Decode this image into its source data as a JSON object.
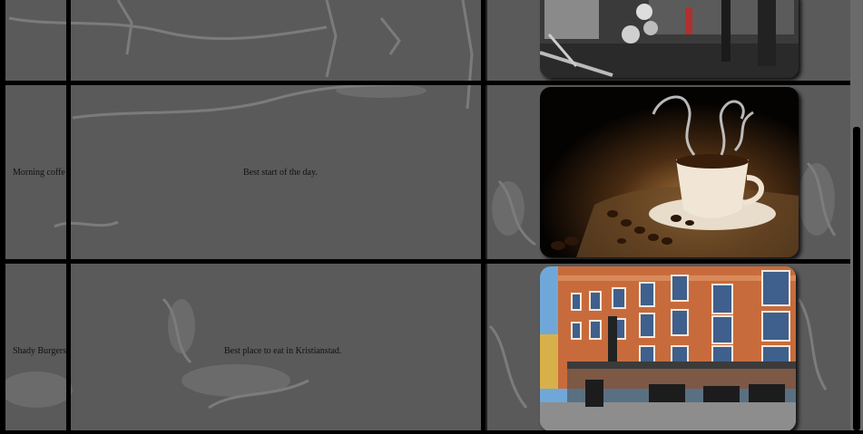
{
  "rows": [
    {
      "name": "",
      "description": "",
      "image": "gym-photo"
    },
    {
      "name": "Morning coffe",
      "description": "Best start of the day.",
      "image": "coffee-photo"
    },
    {
      "name": "Shady Burgers",
      "description": "Best place to eat in Kristianstad.",
      "image": "restaurant-photo"
    }
  ],
  "colors": {
    "background": "#5a5a5a",
    "grid": "#000000",
    "text": "#111111"
  }
}
